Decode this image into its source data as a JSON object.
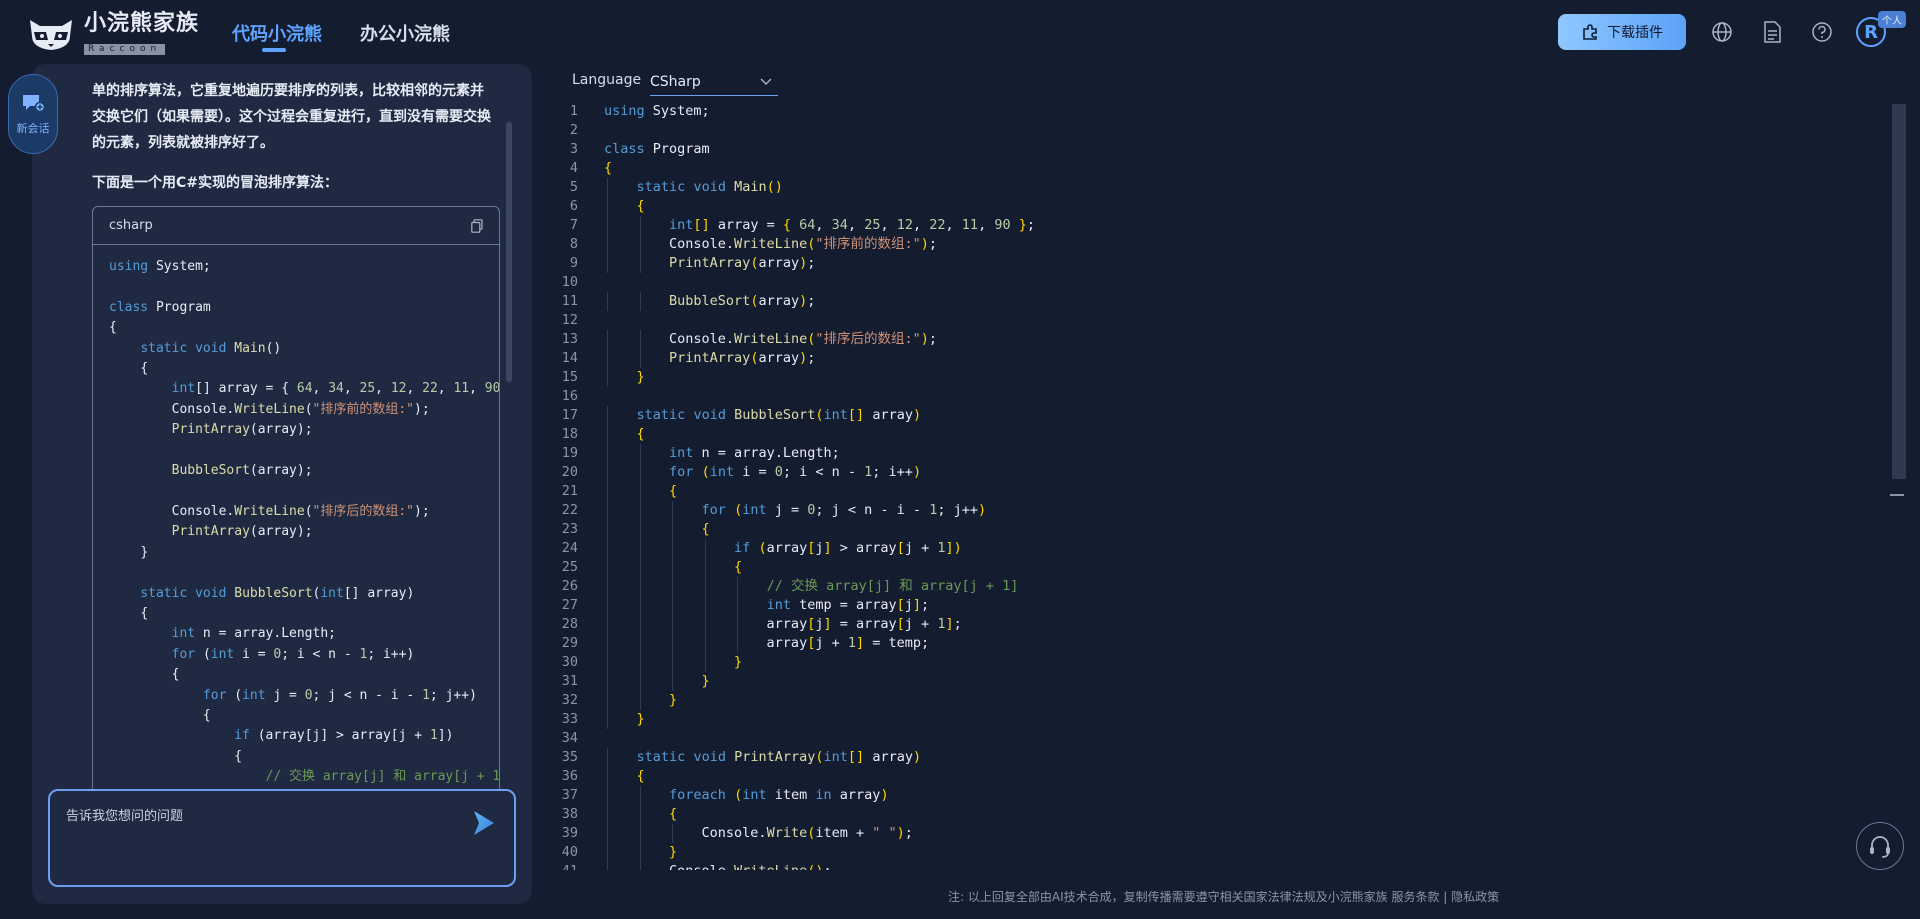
{
  "header": {
    "logo_title": "小浣熊家族",
    "logo_subtitle": "Raccoon",
    "tabs": [
      {
        "label": "代码小浣熊",
        "active": true
      },
      {
        "label": "办公小浣熊",
        "active": false
      }
    ],
    "download_label": "下载插件",
    "avatar_letter": "R",
    "avatar_badge": "个人",
    "icons": [
      "globe-icon",
      "document-icon",
      "help-icon"
    ]
  },
  "chat": {
    "new_chat_label": "新会话",
    "paragraph1": "单的排序算法，它重复地遍历要排序的列表，比较相邻的元素并交换它们（如果需要）。这个过程会重复进行，直到没有需要交换的元素，列表就被排序好了。",
    "paragraph2": "下面是一个用C#实现的冒泡排序算法：",
    "code_lang": "csharp",
    "input_placeholder": "告诉我您想问的问题",
    "code_lines": [
      "using System;",
      "",
      "class Program",
      "{",
      "    static void Main()",
      "    {",
      "        int[] array = { 64, 34, 25, 12, 22, 11, 90",
      "        Console.WriteLine(\"排序前的数组:\");",
      "        PrintArray(array);",
      "",
      "        BubbleSort(array);",
      "",
      "        Console.WriteLine(\"排序后的数组:\");",
      "        PrintArray(array);",
      "    }",
      "",
      "    static void BubbleSort(int[] array)",
      "    {",
      "        int n = array.Length;",
      "        for (int i = 0; i < n - 1; i++)",
      "        {",
      "            for (int j = 0; j < n - i - 1; j++)",
      "            {",
      "                if (array[j] > array[j + 1])",
      "                {",
      "                    // 交换 array[j] 和 array[j + 1"
    ]
  },
  "editor": {
    "language_label": "Language",
    "language_value": "CSharp",
    "lines": [
      "using System;",
      "",
      "class Program",
      "{",
      "    static void Main()",
      "    {",
      "        int[] array = { 64, 34, 25, 12, 22, 11, 90 };",
      "        Console.WriteLine(\"排序前的数组:\");",
      "        PrintArray(array);",
      "",
      "        BubbleSort(array);",
      "",
      "        Console.WriteLine(\"排序后的数组:\");",
      "        PrintArray(array);",
      "    }",
      "",
      "    static void BubbleSort(int[] array)",
      "    {",
      "        int n = array.Length;",
      "        for (int i = 0; i < n - 1; i++)",
      "        {",
      "            for (int j = 0; j < n - i - 1; j++)",
      "            {",
      "                if (array[j] > array[j + 1])",
      "                {",
      "                    // 交换 array[j] 和 array[j + 1]",
      "                    int temp = array[j];",
      "                    array[j] = array[j + 1];",
      "                    array[j + 1] = temp;",
      "                }",
      "            }",
      "        }",
      "    }",
      "",
      "    static void PrintArray(int[] array)",
      "    {",
      "        foreach (int item in array)",
      "        {",
      "            Console.Write(item + \" \");",
      "        }",
      "        Console.WriteLine();"
    ]
  },
  "footer": {
    "notice": "注: 以上回复全部由AI技术合成，复制传播需要遵守相关国家法律法规及小浣熊家族",
    "terms_link": "服务条款",
    "separator": "|",
    "privacy_link": "隐私政策"
  }
}
